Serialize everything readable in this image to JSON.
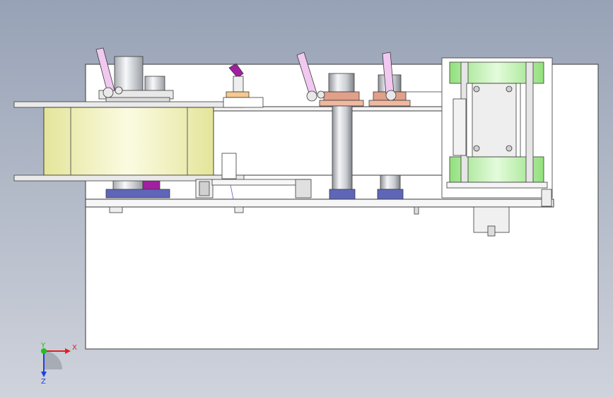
{
  "viewport": {
    "background_top": "#97a2b6",
    "background_bottom": "#cfd3dc"
  },
  "colors": {
    "line": "#3a3a3a",
    "panel": "#ffffff",
    "reel_face": "#f1f2c6",
    "roller": "#cfd2d6",
    "lever": "#e6b2e6",
    "copper": "#e0a08a",
    "green_guide": "#b8f0a8",
    "blue_foot": "#5f66b8",
    "purple": "#a020a0",
    "axis_x": "#e02020",
    "axis_y": "#20c020",
    "axis_z": "#2040e0"
  },
  "triad": {
    "x_label": "X",
    "y_label": "Y",
    "z_label": "Z"
  }
}
